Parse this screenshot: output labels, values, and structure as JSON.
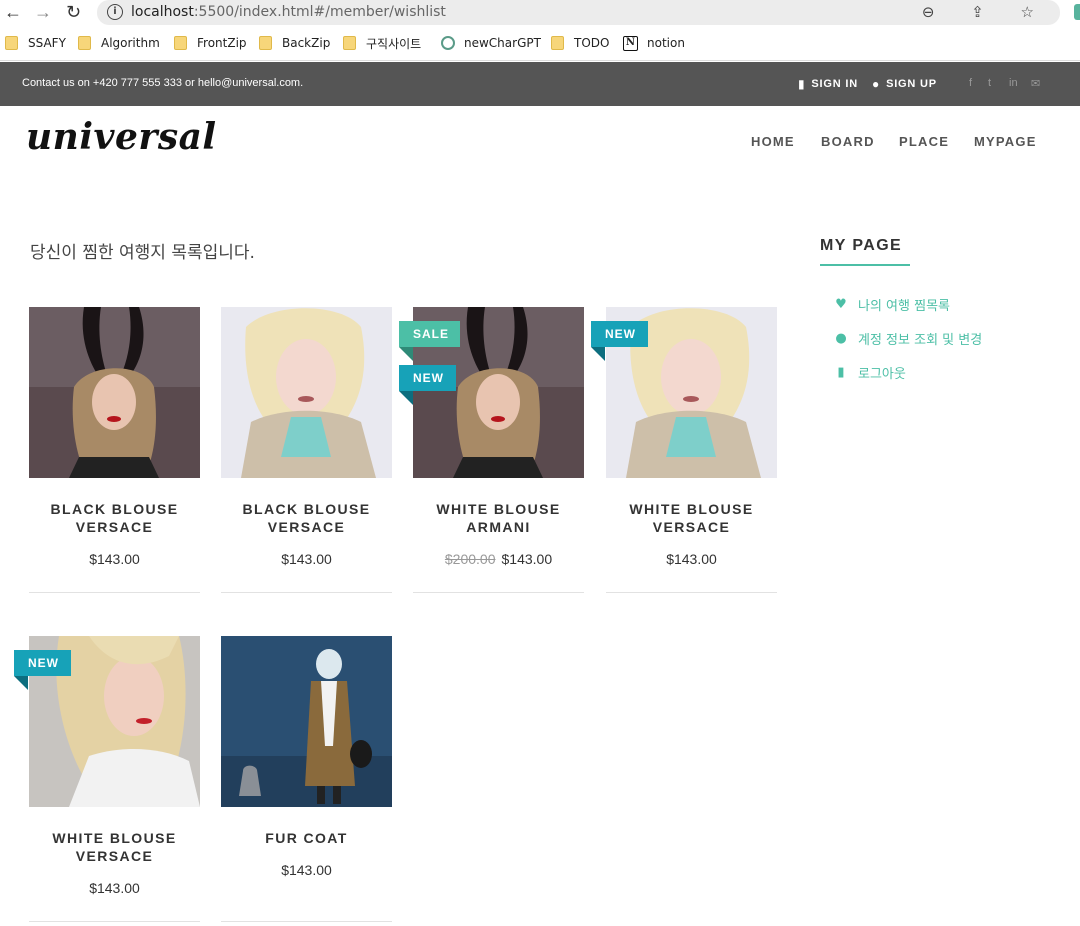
{
  "browser": {
    "back_icon": "←",
    "forward_icon": "→",
    "reload_icon": "↻",
    "url_host": "localhost",
    "url_path": ":5500/index.html#/member/wishlist",
    "tool_icons": "⊖ ⇪ ☆"
  },
  "bookmarks": [
    {
      "label": "SSAFY",
      "icon": "folder-icon"
    },
    {
      "label": "Algorithm",
      "icon": "folder-icon"
    },
    {
      "label": "FrontZip",
      "icon": "folder-icon"
    },
    {
      "label": "BackZip",
      "icon": "folder-icon"
    },
    {
      "label": "구직사이트",
      "icon": "folder-icon"
    },
    {
      "label": "newCharGPT",
      "icon": "chatgpt-icon"
    },
    {
      "label": "TODO",
      "icon": "folder-icon"
    },
    {
      "label": "notion",
      "icon": "notion-icon"
    }
  ],
  "topbar": {
    "contact": "Contact us on +420 777 555 333 or hello@universal.com.",
    "sign_in": "SIGN IN",
    "sign_up": "SIGN UP",
    "social_icons": [
      "f",
      "t",
      "in",
      "✉"
    ]
  },
  "header": {
    "logo": "universal",
    "nav": [
      "HOME",
      "BOARD",
      "PLACE",
      "MYPAGE"
    ]
  },
  "main": {
    "intro": "당신이 찜한 여행지 목록입니다."
  },
  "products": [
    {
      "name_line1": "BLACK BLOUSE",
      "name_line2": "VERSACE",
      "price": "$143.00",
      "old_price": "",
      "badges": [],
      "image": "woman-bunny-ears"
    },
    {
      "name_line1": "BLACK BLOUSE",
      "name_line2": "VERSACE",
      "price": "$143.00",
      "old_price": "",
      "badges": [],
      "image": "blonde-woman"
    },
    {
      "name_line1": "WHITE BLOUSE",
      "name_line2": "ARMANI",
      "price": "$143.00",
      "old_price": "$200.00",
      "badges": [
        "SALE",
        "NEW"
      ],
      "image": "woman-bunny-ears"
    },
    {
      "name_line1": "WHITE BLOUSE",
      "name_line2": "VERSACE",
      "price": "$143.00",
      "old_price": "",
      "badges": [
        "NEW"
      ],
      "image": "blonde-woman"
    },
    {
      "name_line1": "WHITE BLOUSE",
      "name_line2": "VERSACE",
      "price": "$143.00",
      "old_price": "",
      "badges": [
        "NEW"
      ],
      "image": "blonde-closeup"
    },
    {
      "name_line1": "FUR COAT",
      "name_line2": "",
      "price": "$143.00",
      "old_price": "",
      "badges": [],
      "image": "fur-coat-tiger"
    }
  ],
  "sidebar": {
    "title": "MY PAGE",
    "items": [
      {
        "label": "나의 여행 찜목록",
        "icon": "heart-icon"
      },
      {
        "label": "계정 정보 조회 및 변경",
        "icon": "user-icon"
      },
      {
        "label": "로그아웃",
        "icon": "door-icon"
      }
    ]
  },
  "colors": {
    "accent": "#4cbfa6",
    "new_badge": "#17a2b8",
    "topbar": "#555555"
  }
}
